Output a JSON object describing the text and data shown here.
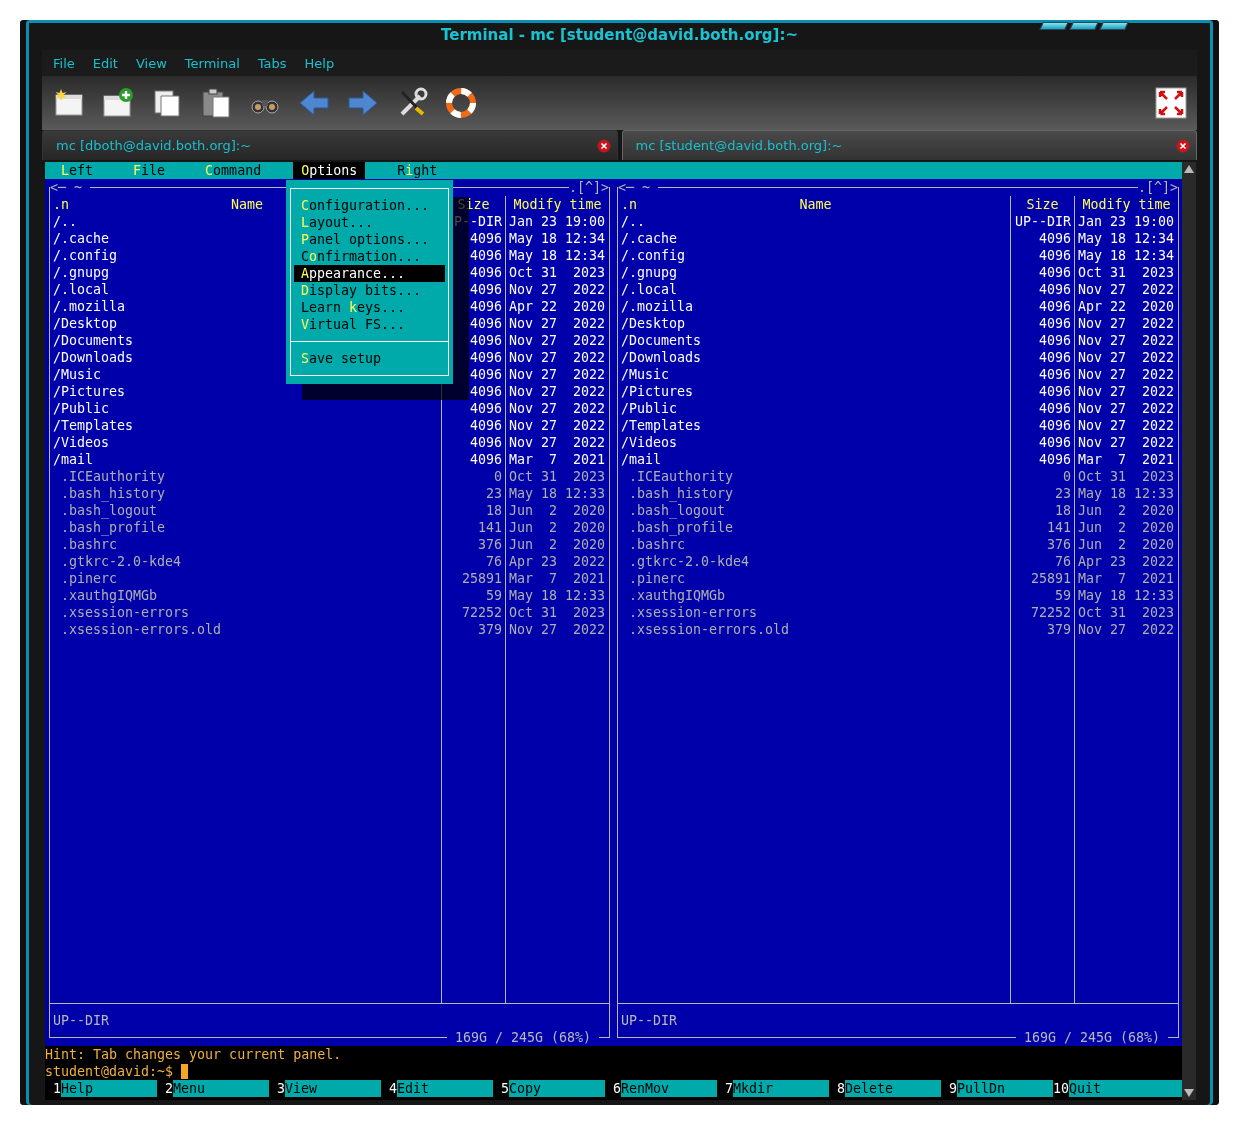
{
  "window": {
    "title": "Terminal - mc [student@david.both.org]:~"
  },
  "menu": [
    "File",
    "Edit",
    "View",
    "Terminal",
    "Tabs",
    "Help"
  ],
  "tabs": [
    {
      "label": "mc [dboth@david.both.org]:~",
      "selected": false
    },
    {
      "label": "mc [student@david.both.org]:~",
      "selected": true
    }
  ],
  "mc_menu": [
    {
      "label": "**L**eft",
      "selected": false
    },
    {
      "label": "**F**ile",
      "selected": false
    },
    {
      "label": "**C**ommand",
      "selected": false
    },
    {
      "label": "**O**ptions",
      "selected": true
    },
    {
      "label": "R**i**ght",
      "selected": false
    }
  ],
  "options_menu": {
    "groups": [
      [
        {
          "label": "**C**onfiguration...",
          "selected": false
        },
        {
          "label": "**L**ayout...",
          "selected": false
        },
        {
          "label": "**P**anel options...",
          "selected": false
        },
        {
          "label": "C**o**nfirmation...",
          "selected": false
        },
        {
          "label": "**A**ppearance...",
          "selected": true
        },
        {
          "label": "**D**isplay bits...",
          "selected": false
        },
        {
          "label": "Learn **k**eys...",
          "selected": false
        },
        {
          "label": "**V**irtual FS...",
          "selected": false
        }
      ],
      [
        {
          "label": "**S**ave setup",
          "selected": false
        }
      ]
    ]
  },
  "panels": [
    {
      "nav": "<─",
      "path": "~",
      "corner": ".[^]>",
      "headers": {
        "sort": ".n",
        "name": "Name",
        "size": "Size",
        "time": "Modify time"
      },
      "rows": [
        {
          "name": "/..",
          "size": "P--DIR",
          "time": "Jan 23 19:00",
          "kind": "dir"
        },
        {
          "name": "/.cache",
          "size": "4096",
          "time": "May 18 12:34",
          "kind": "dir"
        },
        {
          "name": "/.config",
          "size": "4096",
          "time": "May 18 12:34",
          "kind": "dir"
        },
        {
          "name": "/.gnupg",
          "size": "4096",
          "time": "Oct 31  2023",
          "kind": "dir"
        },
        {
          "name": "/.local",
          "size": "4096",
          "time": "Nov 27  2022",
          "kind": "dir"
        },
        {
          "name": "/.mozilla",
          "size": "4096",
          "time": "Apr 22  2020",
          "kind": "dir"
        },
        {
          "name": "/Desktop",
          "size": "4096",
          "time": "Nov 27  2022",
          "kind": "dir"
        },
        {
          "name": "/Documents",
          "size": "4096",
          "time": "Nov 27  2022",
          "kind": "dir"
        },
        {
          "name": "/Downloads",
          "size": "4096",
          "time": "Nov 27  2022",
          "kind": "dir"
        },
        {
          "name": "/Music",
          "size": "4096",
          "time": "Nov 27  2022",
          "kind": "dir"
        },
        {
          "name": "/Pictures",
          "size": "4096",
          "time": "Nov 27  2022",
          "kind": "dir"
        },
        {
          "name": "/Public",
          "size": "4096",
          "time": "Nov 27  2022",
          "kind": "dir"
        },
        {
          "name": "/Templates",
          "size": "4096",
          "time": "Nov 27  2022",
          "kind": "dir"
        },
        {
          "name": "/Videos",
          "size": "4096",
          "time": "Nov 27  2022",
          "kind": "dir"
        },
        {
          "name": "/mail",
          "size": "4096",
          "time": "Mar  7  2021",
          "kind": "dir"
        },
        {
          "name": ".ICEauthority",
          "size": "0",
          "time": "Oct 31  2023",
          "kind": "file"
        },
        {
          "name": ".bash_history",
          "size": "23",
          "time": "May 18 12:33",
          "kind": "file"
        },
        {
          "name": ".bash_logout",
          "size": "18",
          "time": "Jun  2  2020",
          "kind": "file"
        },
        {
          "name": ".bash_profile",
          "size": "141",
          "time": "Jun  2  2020",
          "kind": "file"
        },
        {
          "name": ".bashrc",
          "size": "376",
          "time": "Jun  2  2020",
          "kind": "file"
        },
        {
          "name": ".gtkrc-2.0-kde4",
          "size": "76",
          "time": "Apr 23  2022",
          "kind": "file"
        },
        {
          "name": ".pinerc",
          "size": "25891",
          "time": "Mar  7  2021",
          "kind": "file"
        },
        {
          "name": ".xauthgIQMGb",
          "size": "59",
          "time": "May 18 12:33",
          "kind": "file"
        },
        {
          "name": ".xsession-errors",
          "size": "72252",
          "time": "Oct 31  2023",
          "kind": "file"
        },
        {
          "name": ".xsession-errors.old",
          "size": "379",
          "time": "Nov 27  2022",
          "kind": "file"
        }
      ],
      "status": "UP--DIR",
      "disk": "169G / 245G (68%)"
    },
    {
      "nav": "<─",
      "path": "~",
      "corner": ".[^]>",
      "headers": {
        "sort": ".n",
        "name": "Name",
        "size": "Size",
        "time": "Modify time"
      },
      "rows": [
        {
          "name": "/..",
          "size": "UP--DIR",
          "time": "Jan 23 19:00",
          "kind": "dir"
        },
        {
          "name": "/.cache",
          "size": "4096",
          "time": "May 18 12:34",
          "kind": "dir"
        },
        {
          "name": "/.config",
          "size": "4096",
          "time": "May 18 12:34",
          "kind": "dir"
        },
        {
          "name": "/.gnupg",
          "size": "4096",
          "time": "Oct 31  2023",
          "kind": "dir"
        },
        {
          "name": "/.local",
          "size": "4096",
          "time": "Nov 27  2022",
          "kind": "dir"
        },
        {
          "name": "/.mozilla",
          "size": "4096",
          "time": "Apr 22  2020",
          "kind": "dir"
        },
        {
          "name": "/Desktop",
          "size": "4096",
          "time": "Nov 27  2022",
          "kind": "dir"
        },
        {
          "name": "/Documents",
          "size": "4096",
          "time": "Nov 27  2022",
          "kind": "dir"
        },
        {
          "name": "/Downloads",
          "size": "4096",
          "time": "Nov 27  2022",
          "kind": "dir"
        },
        {
          "name": "/Music",
          "size": "4096",
          "time": "Nov 27  2022",
          "kind": "dir"
        },
        {
          "name": "/Pictures",
          "size": "4096",
          "time": "Nov 27  2022",
          "kind": "dir"
        },
        {
          "name": "/Public",
          "size": "4096",
          "time": "Nov 27  2022",
          "kind": "dir"
        },
        {
          "name": "/Templates",
          "size": "4096",
          "time": "Nov 27  2022",
          "kind": "dir"
        },
        {
          "name": "/Videos",
          "size": "4096",
          "time": "Nov 27  2022",
          "kind": "dir"
        },
        {
          "name": "/mail",
          "size": "4096",
          "time": "Mar  7  2021",
          "kind": "dir"
        },
        {
          "name": ".ICEauthority",
          "size": "0",
          "time": "Oct 31  2023",
          "kind": "file"
        },
        {
          "name": ".bash_history",
          "size": "23",
          "time": "May 18 12:33",
          "kind": "file"
        },
        {
          "name": ".bash_logout",
          "size": "18",
          "time": "Jun  2  2020",
          "kind": "file"
        },
        {
          "name": ".bash_profile",
          "size": "141",
          "time": "Jun  2  2020",
          "kind": "file"
        },
        {
          "name": ".bashrc",
          "size": "376",
          "time": "Jun  2  2020",
          "kind": "file"
        },
        {
          "name": ".gtkrc-2.0-kde4",
          "size": "76",
          "time": "Apr 23  2022",
          "kind": "file"
        },
        {
          "name": ".pinerc",
          "size": "25891",
          "time": "Mar  7  2021",
          "kind": "file"
        },
        {
          "name": ".xauthgIQMGb",
          "size": "59",
          "time": "May 18 12:33",
          "kind": "file"
        },
        {
          "name": ".xsession-errors",
          "size": "72252",
          "time": "Oct 31  2023",
          "kind": "file"
        },
        {
          "name": ".xsession-errors.old",
          "size": "379",
          "time": "Nov 27  2022",
          "kind": "file"
        }
      ],
      "status": "UP--DIR",
      "disk": "169G / 245G (68%)"
    }
  ],
  "hint": "Hint: Tab changes your current panel.",
  "prompt": "student@david:~$",
  "keys": [
    {
      "key": "1",
      "label": "Help"
    },
    {
      "key": "2",
      "label": "Menu"
    },
    {
      "key": "3",
      "label": "View"
    },
    {
      "key": "4",
      "label": "Edit"
    },
    {
      "key": "5",
      "label": "Copy"
    },
    {
      "key": "6",
      "label": "RenMov"
    },
    {
      "key": "7",
      "label": "Mkdir"
    },
    {
      "key": "8",
      "label": "Delete"
    },
    {
      "key": "9",
      "label": "PullDn"
    },
    {
      "key": "10",
      "label": "Quit"
    }
  ]
}
